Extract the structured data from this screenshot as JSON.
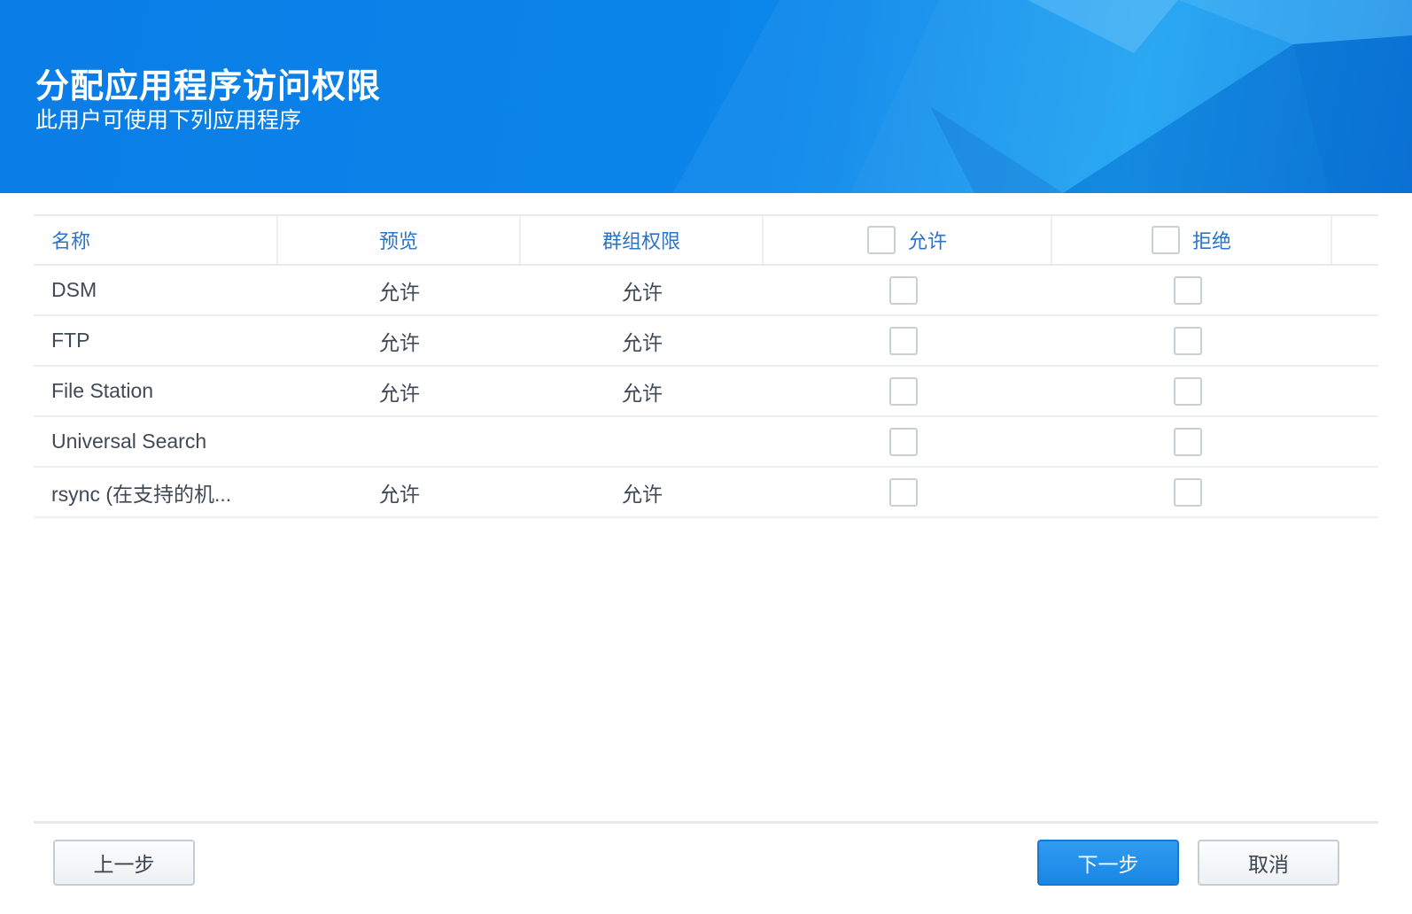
{
  "header": {
    "title": "分配应用程序访问权限",
    "subtitle": "此用户可使用下列应用程序"
  },
  "table": {
    "columns": {
      "name": "名称",
      "preview": "预览",
      "group_permission": "群组权限",
      "allow": "允许",
      "deny": "拒绝"
    },
    "rows": [
      {
        "name": "DSM",
        "preview": "允许",
        "group_permission": "允许",
        "allow_checked": false,
        "deny_checked": false
      },
      {
        "name": "FTP",
        "preview": "允许",
        "group_permission": "允许",
        "allow_checked": false,
        "deny_checked": false
      },
      {
        "name": "File Station",
        "preview": "允许",
        "group_permission": "允许",
        "allow_checked": false,
        "deny_checked": false
      },
      {
        "name": "Universal Search",
        "preview": "",
        "group_permission": "",
        "allow_checked": false,
        "deny_checked": false
      },
      {
        "name": "rsync (在支持的机...",
        "preview": "允许",
        "group_permission": "允许",
        "allow_checked": false,
        "deny_checked": false
      }
    ]
  },
  "buttons": {
    "back": "上一步",
    "next": "下一步",
    "cancel": "取消"
  },
  "colors": {
    "banner": "#0b86ea",
    "header_text": "#2b74c7",
    "primary_button": "#1a86e4"
  }
}
